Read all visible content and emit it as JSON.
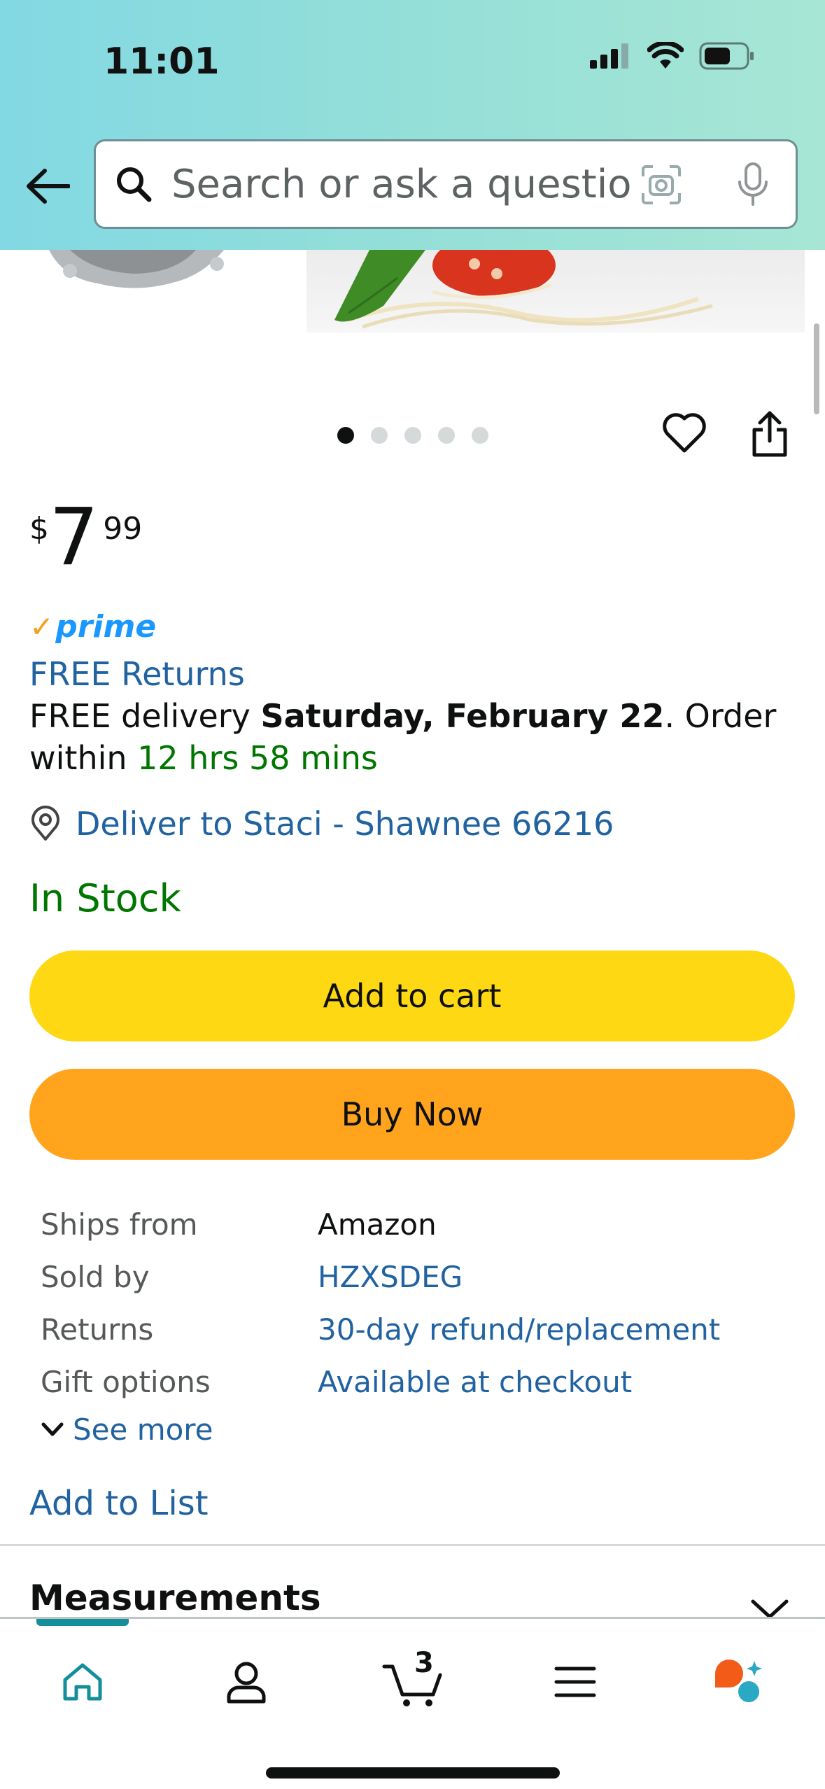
{
  "status_bar": {
    "time": "11:01"
  },
  "search": {
    "placeholder": "Search or ask a question"
  },
  "carousel": {
    "dot_count": 5,
    "active_index": 0
  },
  "price": {
    "currency": "$",
    "whole": "7",
    "fraction": "99"
  },
  "prime": {
    "label": "prime"
  },
  "returns": {
    "label": "FREE Returns"
  },
  "delivery": {
    "prefix": "FREE delivery ",
    "date": "Saturday, February 22",
    "mid": ". Order",
    "within": "within ",
    "countdown": "12 hrs 58 mins"
  },
  "deliver_to": {
    "label": "Deliver to Staci - Shawnee 66216"
  },
  "stock": {
    "label": "In Stock"
  },
  "buttons": {
    "add_to_cart": "Add to cart",
    "buy_now": "Buy Now"
  },
  "details": [
    {
      "key": "Ships from",
      "value": "Amazon"
    },
    {
      "key": "Sold by",
      "value": "HZXSDEG"
    },
    {
      "key": "Returns",
      "value": "30-day refund/replacement"
    },
    {
      "key": "Gift options",
      "value": "Available at checkout"
    }
  ],
  "see_more": {
    "label": "See more"
  },
  "add_to_list": {
    "label": "Add to List"
  },
  "section": {
    "title": "Measurements"
  },
  "tabbar": {
    "cart_count": "3",
    "items": [
      "home-icon",
      "account-icon",
      "cart-icon",
      "menu-icon",
      "rufus-icon"
    ]
  },
  "colors": {
    "link": "#2162a1",
    "green": "#007600",
    "cart_button": "#ffd814",
    "buy_button": "#ffa41c",
    "prime_blue": "#1a98ff",
    "accent_teal": "#138e9b"
  }
}
